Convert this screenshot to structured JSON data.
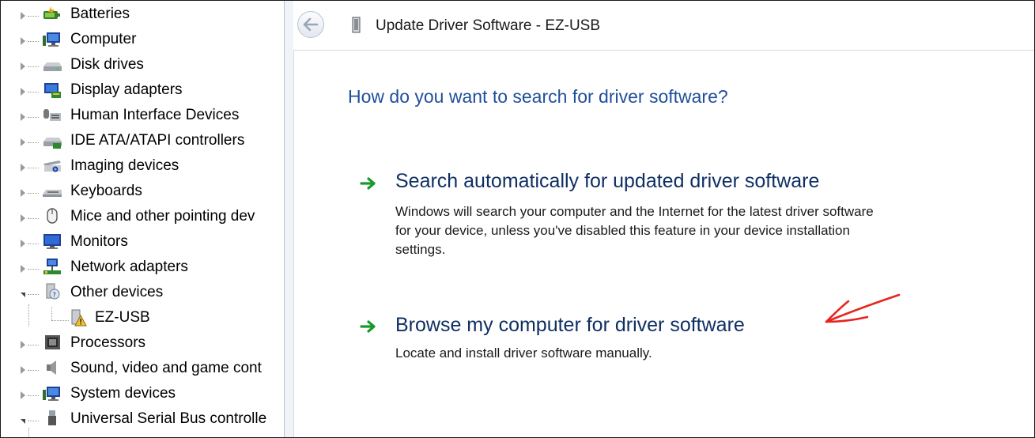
{
  "device_tree": {
    "items": [
      {
        "label": "Batteries",
        "icon": "battery-icon",
        "expanded": false
      },
      {
        "label": "Computer",
        "icon": "computer-icon",
        "expanded": false
      },
      {
        "label": "Disk drives",
        "icon": "disk-drive-icon",
        "expanded": false
      },
      {
        "label": "Display adapters",
        "icon": "display-adapter-icon",
        "expanded": false
      },
      {
        "label": "Human Interface Devices",
        "icon": "hid-icon",
        "expanded": false
      },
      {
        "label": "IDE ATA/ATAPI controllers",
        "icon": "ide-controller-icon",
        "expanded": false
      },
      {
        "label": "Imaging devices",
        "icon": "imaging-device-icon",
        "expanded": false
      },
      {
        "label": "Keyboards",
        "icon": "keyboard-icon",
        "expanded": false
      },
      {
        "label": "Mice and other pointing dev",
        "icon": "mouse-icon",
        "expanded": false
      },
      {
        "label": "Monitors",
        "icon": "monitor-icon",
        "expanded": false
      },
      {
        "label": "Network adapters",
        "icon": "network-adapter-icon",
        "expanded": false
      },
      {
        "label": "Other devices",
        "icon": "unknown-device-icon",
        "expanded": true
      },
      {
        "label": "EZ-USB",
        "icon": "warning-device-icon",
        "child": true
      },
      {
        "label": "Processors",
        "icon": "processor-icon",
        "expanded": false
      },
      {
        "label": "Sound, video and game cont",
        "icon": "speaker-icon",
        "expanded": false
      },
      {
        "label": "System devices",
        "icon": "system-device-icon",
        "expanded": false
      },
      {
        "label": "Universal Serial Bus controlle",
        "icon": "usb-icon",
        "expanded": true
      }
    ]
  },
  "dialog": {
    "title": "Update Driver Software - EZ-USB",
    "heading": "How do you want to search for driver software?",
    "options": [
      {
        "title": "Search automatically for updated driver software",
        "description_lines": [
          "Windows will search your computer and the Internet for the latest driver software",
          "for your device, unless you've disabled this feature in your device installation",
          "settings."
        ]
      },
      {
        "title": "Browse my computer for driver software",
        "description_lines": [
          "Locate and install driver software manually."
        ]
      }
    ]
  },
  "colors": {
    "heading": "#1f4f9a",
    "option_title": "#0f2f63",
    "arrow_green": "#1a9a2a",
    "annotation_red": "#e8231e"
  }
}
